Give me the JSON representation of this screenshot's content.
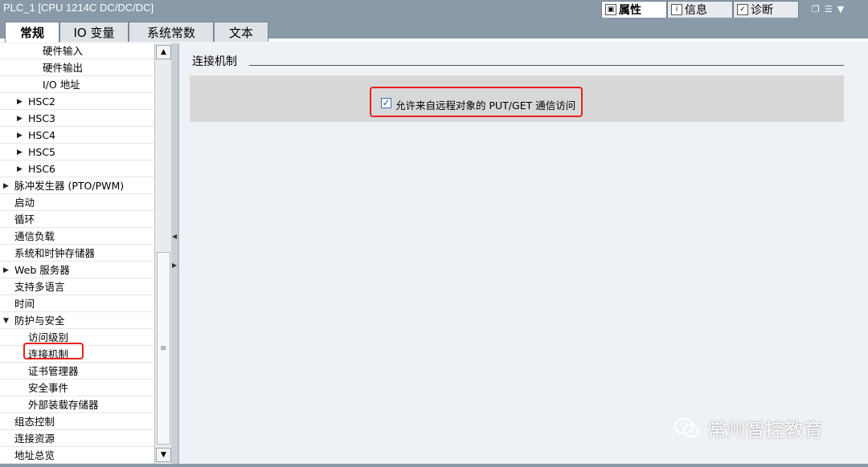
{
  "window": {
    "title": "PLC_1 [CPU 1214C DC/DC/DC]",
    "top_tabs": [
      {
        "label": "属性",
        "icon": "properties-icon",
        "active": true
      },
      {
        "label": "信息",
        "icon": "info-icon",
        "active": false
      },
      {
        "label": "诊断",
        "icon": "diagnostics-icon",
        "active": false
      }
    ]
  },
  "tabs": [
    "常规",
    "IO 变量",
    "系统常数",
    "文本"
  ],
  "tree": [
    {
      "label": "硬件输入",
      "indent": 2,
      "arrow": ""
    },
    {
      "label": "硬件输出",
      "indent": 2,
      "arrow": ""
    },
    {
      "label": "I/O 地址",
      "indent": 2,
      "arrow": ""
    },
    {
      "label": "HSC2",
      "indent": 1,
      "arrow": "▶"
    },
    {
      "label": "HSC3",
      "indent": 1,
      "arrow": "▶"
    },
    {
      "label": "HSC4",
      "indent": 1,
      "arrow": "▶"
    },
    {
      "label": "HSC5",
      "indent": 1,
      "arrow": "▶"
    },
    {
      "label": "HSC6",
      "indent": 1,
      "arrow": "▶"
    },
    {
      "label": "脉冲发生器 (PTO/PWM)",
      "indent": 0,
      "arrow": "▶"
    },
    {
      "label": "启动",
      "indent": 0,
      "arrow": ""
    },
    {
      "label": "循环",
      "indent": 0,
      "arrow": ""
    },
    {
      "label": "通信负载",
      "indent": 0,
      "arrow": ""
    },
    {
      "label": "系统和时钟存储器",
      "indent": 0,
      "arrow": ""
    },
    {
      "label": "Web 服务器",
      "indent": 0,
      "arrow": "▶"
    },
    {
      "label": "支持多语言",
      "indent": 0,
      "arrow": ""
    },
    {
      "label": "时间",
      "indent": 0,
      "arrow": ""
    },
    {
      "label": "防护与安全",
      "indent": 0,
      "arrow": "▼"
    },
    {
      "label": "访问级别",
      "indent": 1,
      "arrow": ""
    },
    {
      "label": "连接机制",
      "indent": 1,
      "arrow": ""
    },
    {
      "label": "证书管理器",
      "indent": 1,
      "arrow": ""
    },
    {
      "label": "安全事件",
      "indent": 1,
      "arrow": ""
    },
    {
      "label": "外部装载存储器",
      "indent": 1,
      "arrow": ""
    },
    {
      "label": "组态控制",
      "indent": 0,
      "arrow": ""
    },
    {
      "label": "连接资源",
      "indent": 0,
      "arrow": ""
    },
    {
      "label": "地址总览",
      "indent": 0,
      "arrow": ""
    }
  ],
  "content": {
    "section_title": "连接机制",
    "checkbox_label": "允许来自远程对象的 PUT/GET 通信访问",
    "checkbox_checked": true
  },
  "watermark": "常州智控教育",
  "colors": {
    "highlight": "#e8211d",
    "titlebar": "#8a9aa8"
  }
}
